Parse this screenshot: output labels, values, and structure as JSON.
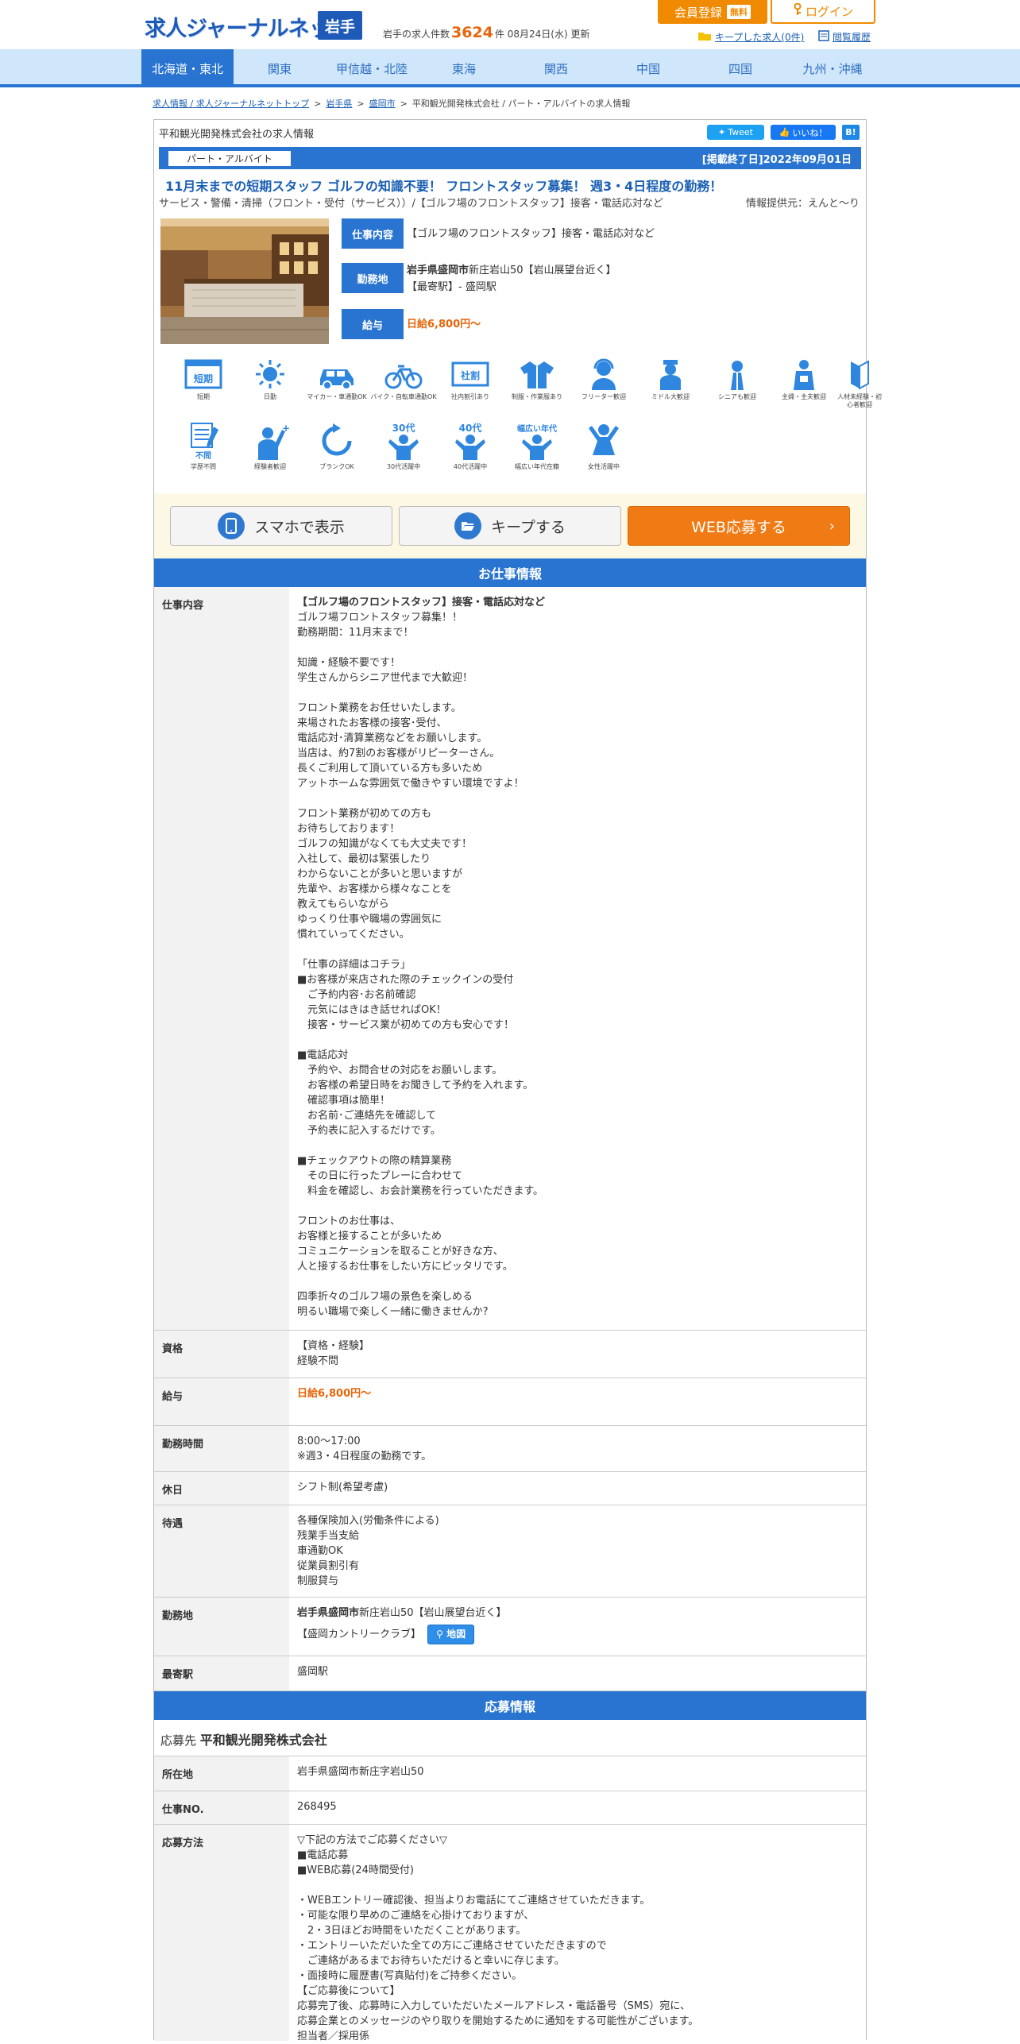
{
  "header": {
    "logo_text": "求人ジャーナルネット",
    "pref": "岩手",
    "count_prefix": "岩手の求人件数",
    "count": "3624",
    "count_suffix": "件 08月24日(水) 更新",
    "register_label": "会員登録",
    "register_badge": "無料",
    "login_label": "ログイン",
    "keep_label": "キープした求人(0件)",
    "history_label": "閲覧履歴"
  },
  "nav": {
    "items": [
      "北海道・東北",
      "関東",
      "甲信越・北陸",
      "東海",
      "関西",
      "中国",
      "四国",
      "九州・沖縄"
    ]
  },
  "breadcrumb": {
    "items": [
      "求人情報 / 求人ジャーナルネットトップ",
      "岩手県",
      "盛岡市"
    ],
    "current": "平和観光開発株式会社 / パート・アルバイトの求人情報"
  },
  "job": {
    "company_heading": "平和観光開発株式会社の求人情報",
    "tweet": "Tweet",
    "like": "いいね！",
    "hatena": "B!",
    "employment_type": "パート・アルバイト",
    "end_date": "[掲載終了日]2022年09月01日",
    "title": "11月末までの短期スタッフ ゴルフの知識不要！ フロントスタッフ募集！ 週3・4日程度の勤務！",
    "subtitle": "サービス・警備・清掃（フロント・受付（サービス））/【ゴルフ場のフロントスタッフ】接客・電話応対など",
    "provider": "情報提供元：えんと～り",
    "summary": {
      "work_label": "仕事内容",
      "work_value": "【ゴルフ場のフロントスタッフ】接客・電話応対など",
      "location_label": "勤務地",
      "location_bold": "岩手県盛岡市",
      "location_rest": "新庄岩山50【岩山展望台近く】",
      "location_station": "【最寄駅】- 盛岡駅",
      "salary_label": "給与",
      "salary_value": "日給6,800円～"
    }
  },
  "features": [
    {
      "label": "短期",
      "icon": "short-term-icon"
    },
    {
      "label": "日勤",
      "icon": "sun-icon"
    },
    {
      "label": "マイカー・車通勤OK",
      "icon": "car-icon"
    },
    {
      "label": "バイク・自転車通勤OK",
      "icon": "bicycle-icon"
    },
    {
      "label": "社内割引あり",
      "icon": "discount-icon"
    },
    {
      "label": "制服・作業服あり",
      "icon": "uniform-icon"
    },
    {
      "label": "フリーター歓迎",
      "icon": "freeter-icon"
    },
    {
      "label": "ミドル大歓迎",
      "icon": "middle-icon"
    },
    {
      "label": "シニアも歓迎",
      "icon": "senior-icon"
    },
    {
      "label": "主婦・主夫歓迎",
      "icon": "apron-icon"
    },
    {
      "label": "人材未経験・初心者歓迎",
      "icon": "beginner-icon"
    },
    {
      "label": "学歴不問",
      "icon": "education-icon"
    },
    {
      "label": "経験者歓迎",
      "icon": "experienced-icon"
    },
    {
      "label": "ブランクOK",
      "icon": "blank-ok-icon"
    },
    {
      "label": "30代活躍中",
      "icon": "thirties-icon",
      "badge": "30代"
    },
    {
      "label": "40代活躍中",
      "icon": "forties-icon",
      "badge": "40代"
    },
    {
      "label": "幅広い年代在籍",
      "icon": "all-ages-icon",
      "badge": "幅広い年代"
    },
    {
      "label": "女性活躍中",
      "icon": "women-icon"
    }
  ],
  "cta": {
    "phone": "スマホで表示",
    "keep": "キープする",
    "apply": "WEB応募する"
  },
  "work_section": {
    "heading": "お仕事情報",
    "job_label": "仕事内容",
    "job_head": "【ゴルフ場のフロントスタッフ】接客・電話応対など",
    "job_body": "ゴルフ場フロントスタッフ募集！！\n勤務期間：11月末まで！\n\n知識・経験不要です！\n学生さんからシニア世代まで大歓迎！\n\nフロント業務をお任せいたします。\n来場されたお客様の接客･受付、\n電話応対･清算業務などをお願いします。\n当店は、約7割のお客様がリピーターさん。\n長くご利用して頂いている方も多いため\nアットホームな雰囲気で働きやすい環境ですよ！\n\nフロント業務が初めての方も\nお待ちしております！\nゴルフの知識がなくても大丈夫です！\n入社して、最初は緊張したり\nわからないことが多いと思いますが\n先輩や、お客様から様々なことを\n教えてもらいながら\nゆっくり仕事や職場の雰囲気に\n慣れていってください。\n\n「仕事の詳細はコチラ」\n■お客様が来店された際のチェックインの受付\n　ご予約内容･お名前確認\n　元気にはきはき話せればOK！\n　接客・サービス業が初めての方も安心です！\n\n■電話応対\n　予約や、お問合せの対応をお願いします。\n　お客様の希望日時をお聞きして予約を入れます。\n　確認事項は簡単！\n　お名前･ご連絡先を確認して\n　予約表に記入するだけです。\n\n■チェックアウトの際の精算業務\n　その日に行ったプレーに合わせて\n　料金を確認し、お会計業務を行っていただきます。\n\nフロントのお仕事は、\nお客様と接することが多いため\nコミュニケーションを取ることが好きな方、\n人と接するお仕事をしたい方にピッタリです。\n\n四季折々のゴルフ場の景色を楽しめる\n明るい職場で楽しく一緒に働きませんか?",
    "qual_label": "資格",
    "qual_value": "【資格・経験】\n経験不問",
    "salary_label": "給与",
    "salary_value": "日給6,800円～",
    "hours_label": "勤務時間",
    "hours_value": "8:00～17:00\n※週3・4日程度の勤務です。",
    "holiday_label": "休日",
    "holiday_value": "シフト制(希望考慮)",
    "benefits_label": "待遇",
    "benefits_value": "各種保険加入(労働条件による)\n残業手当支給\n車通勤OK\n従業員割引有\n制服貸与",
    "location_label": "勤務地",
    "location_bold": "岩手県盛岡市",
    "location_rest": "新庄岩山50【岩山展望台近く】",
    "location_place": "【盛岡カントリークラブ】",
    "map_label": "地図",
    "station_label": "最寄駅",
    "station_value": "盛岡駅"
  },
  "apply_section": {
    "heading": "応募情報",
    "apply_to_label": "応募先",
    "apply_to_value": "平和観光開発株式会社",
    "address_label": "所在地",
    "address_value": "岩手県盛岡市新庄字岩山50",
    "jobno_label": "仕事NO.",
    "jobno_value": "268495",
    "method_label": "応募方法",
    "method_value": "▽下記の方法でご応募ください▽\n■電話応募\n■WEB応募(24時間受付)\n\n・WEBエントリー確認後、担当よりお電話にてご連絡させていただきます。\n・可能な限り早めのご連絡を心掛けておりますが、\n　2・3日ほどお時間をいただくことがあります。\n・エントリーいただいた全ての方にご連絡させていただきますので\n　ご連絡があるまでお待ちいただけると幸いに存じます。\n・面接時に履歴書(写真貼付)をご持参ください。\n【ご応募後について】\n応募完了後、応募時に入力していただいたメールアドレス・電話番号（SMS）宛に、\n応募企業とのメッセージのやり取りを開始するために通知をする可能性がございます。\n担当者／採用係"
  },
  "colors": {
    "primary": "#2874d0",
    "accent": "#f08a00",
    "salary": "#e8650a"
  }
}
